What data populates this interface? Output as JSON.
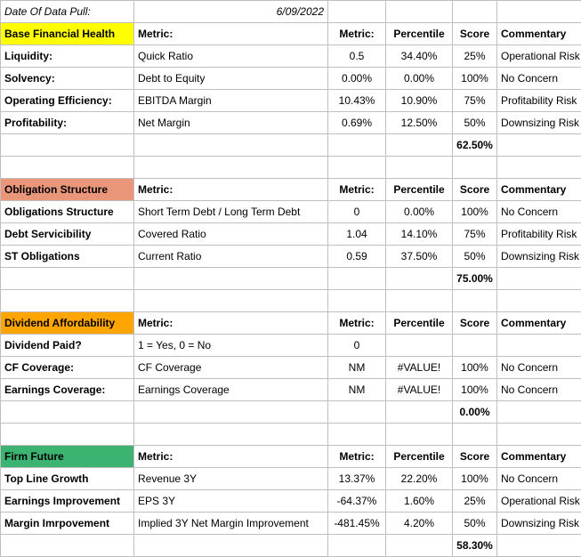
{
  "header": {
    "date_label": "Date Of Data Pull:",
    "date_value": "6/09/2022"
  },
  "col_labels": {
    "metric_name": "Metric:",
    "metric_val": "Metric:",
    "percentile": "Percentile",
    "score": "Score",
    "commentary": "Commentary"
  },
  "sections": [
    {
      "title": "Base Financial Health",
      "bg": "bg-yellow",
      "rows": [
        {
          "label": "Liquidity:",
          "metric": "Quick Ratio",
          "value": "0.5",
          "pct": "34.40%",
          "score": "25%",
          "comm": "Operational Risk"
        },
        {
          "label": "Solvency:",
          "metric": "Debt to Equity",
          "value": "0.00%",
          "pct": "0.00%",
          "score": "100%",
          "comm": "No Concern"
        },
        {
          "label": "Operating Efficiency:",
          "metric": "EBITDA Margin",
          "value": "10.43%",
          "pct": "10.90%",
          "score": "75%",
          "comm": "Profitability Risk"
        },
        {
          "label": "Profitability:",
          "metric": "Net Margin",
          "value": "0.69%",
          "pct": "12.50%",
          "score": "50%",
          "comm": "Downsizing Risk"
        }
      ],
      "total": "62.50%"
    },
    {
      "title": "Obligation Structure",
      "bg": "bg-red",
      "rows": [
        {
          "label": "Obligations Structure",
          "metric": "Short Term Debt / Long Term Debt",
          "value": "0",
          "pct": "0.00%",
          "score": "100%",
          "comm": "No Concern"
        },
        {
          "label": "Debt Servicibility",
          "metric": "Covered Ratio",
          "value": "1.04",
          "pct": "14.10%",
          "score": "75%",
          "comm": "Profitability Risk"
        },
        {
          "label": "ST Obligations",
          "metric": "Current Ratio",
          "value": "0.59",
          "pct": "37.50%",
          "score": "50%",
          "comm": "Downsizing Risk"
        }
      ],
      "total": "75.00%"
    },
    {
      "title": "Dividend Affordability",
      "bg": "bg-orange",
      "rows": [
        {
          "label": "Dividend Paid?",
          "metric": "1 = Yes, 0 = No",
          "value": "0",
          "pct": "",
          "score": "",
          "comm": ""
        },
        {
          "label": "CF Coverage:",
          "metric": "CF Coverage",
          "value": "NM",
          "pct": "#VALUE!",
          "score": "100%",
          "comm": "No Concern"
        },
        {
          "label": "Earnings Coverage:",
          "metric": "Earnings Coverage",
          "value": "NM",
          "pct": "#VALUE!",
          "score": "100%",
          "comm": "No Concern"
        }
      ],
      "total": "0.00%"
    },
    {
      "title": "Firm Future",
      "bg": "bg-green",
      "rows": [
        {
          "label": "Top Line Growth",
          "metric": "Revenue 3Y",
          "value": "13.37%",
          "pct": "22.20%",
          "score": "100%",
          "comm": "No Concern"
        },
        {
          "label": "Earnings Improvement",
          "metric": "EPS 3Y",
          "value": "-64.37%",
          "pct": "1.60%",
          "score": "25%",
          "comm": "Operational Risk"
        },
        {
          "label": "Margin Imrpovement",
          "metric": "Implied 3Y Net Margin Improvement",
          "value": "-481.45%",
          "pct": "4.20%",
          "score": "50%",
          "comm": "Downsizing Risk"
        }
      ],
      "total": "58.30%"
    }
  ]
}
